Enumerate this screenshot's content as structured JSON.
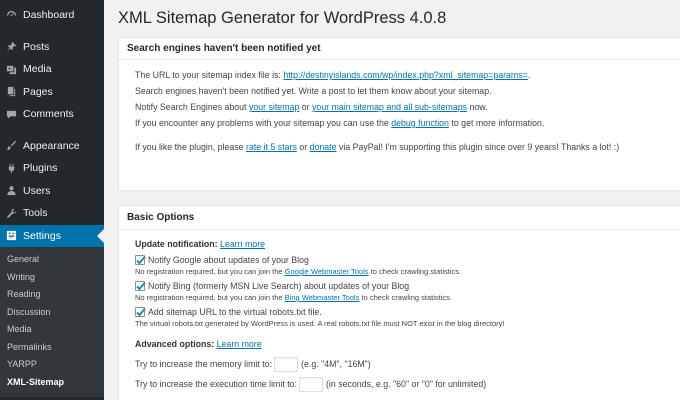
{
  "sidebar": {
    "items": [
      {
        "label": "Dashboard",
        "icon": "dashboard-icon"
      },
      {
        "label": "Posts",
        "icon": "pin-icon"
      },
      {
        "label": "Media",
        "icon": "media-icon"
      },
      {
        "label": "Pages",
        "icon": "pages-icon"
      },
      {
        "label": "Comments",
        "icon": "comments-icon"
      },
      {
        "label": "Appearance",
        "icon": "brush-icon"
      },
      {
        "label": "Plugins",
        "icon": "plugin-icon"
      },
      {
        "label": "Users",
        "icon": "users-icon"
      },
      {
        "label": "Tools",
        "icon": "wrench-icon"
      },
      {
        "label": "Settings",
        "icon": "settings-icon"
      }
    ],
    "submenu": [
      "General",
      "Writing",
      "Reading",
      "Discussion",
      "Media",
      "Permalinks",
      "YARPP",
      "XML-Sitemap"
    ]
  },
  "page": {
    "title": "XML Sitemap Generator for WordPress 4.0.8"
  },
  "notify_box": {
    "title": "Search engines haven't been notified yet",
    "line1_prefix": "The URL to your sitemap index file is: ",
    "line1_link": "http://destinyislands.com/wp/index.php?xml_sitemap=params=",
    "line1_suffix": ".",
    "line2": "Search engines haven't been notified yet. Write a post to let them know about your sitemap.",
    "line3_prefix": "Notify Search Engines about ",
    "line3_link1": "your sitemap",
    "line3_mid": " or ",
    "line3_link2": "your main sitemap and all sub-sitemaps",
    "line3_suffix": " now.",
    "line4_prefix": "If you encounter any problems with your sitemap you can use the ",
    "line4_link": "debug function",
    "line4_suffix": " to get more information.",
    "line5_prefix": "If you like the plugin, please ",
    "line5_link1": "rate it 5 stars",
    "line5_mid": " or ",
    "line5_link2": "donate",
    "line5_suffix": " via PayPal! I'm supporting this plugin since over 9 years! Thanks a lot! :)"
  },
  "basic_box": {
    "title": "Basic Options",
    "update_label": "Update notification:",
    "update_link": "Learn more",
    "google_label": "Notify Google about updates of your Blog",
    "google_desc_prefix": "No registration required, but you can join the ",
    "google_desc_link": "Google Webmaster Tools",
    "google_desc_suffix": " to check crawling statistics.",
    "bing_label": "Notify Bing (formerly MSN Live Search) about updates of your Blog",
    "bing_desc_prefix": "No registration required, but you can join the ",
    "bing_desc_link": "Bing Webmaster Tools",
    "bing_desc_suffix": " to check crawling statistics.",
    "robots_label": "Add sitemap URL to the virtual robots.txt file.",
    "robots_desc": "The virtual robots.txt generated by WordPress is used. A real robots.txt file must NOT exist in the blog directory!",
    "advanced_label": "Advanced options:",
    "advanced_link": "Learn more",
    "memory_label": "Try to increase the memory limit to:",
    "memory_hint": "(e.g. \"4M\", \"16M\")",
    "memory_value": "",
    "time_label": "Try to increase the execution time limit to:",
    "time_hint": "(in seconds, e.g. \"60\" or \"0\" for unlimited)",
    "time_value": ""
  },
  "colors": {
    "sidebar_bg": "#23282d",
    "active_bg": "#0073aa",
    "link": "#0073aa",
    "checkmark": "#1e8cbe"
  }
}
